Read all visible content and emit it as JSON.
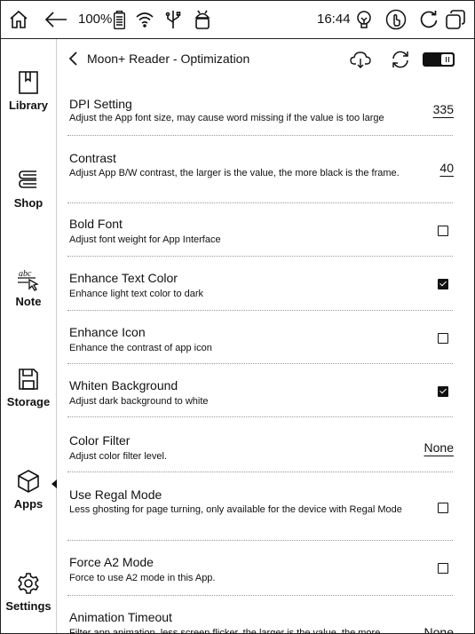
{
  "status_bar": {
    "battery_percent": "100%",
    "time": "16:44",
    "icons": [
      "home-icon",
      "back-arrow-icon",
      "battery-icon",
      "wifi-icon",
      "usb-icon",
      "android-icon",
      "bulb-icon",
      "touch-icon",
      "refresh-icon",
      "multitask-icon"
    ]
  },
  "sidebar": {
    "items": [
      {
        "label": "Library",
        "icon": "library-icon"
      },
      {
        "label": "Shop",
        "icon": "shop-icon"
      },
      {
        "label": "Note",
        "icon": "note-icon"
      },
      {
        "label": "Storage",
        "icon": "storage-icon"
      },
      {
        "label": "Apps",
        "icon": "apps-icon"
      },
      {
        "label": "Settings",
        "icon": "settings-icon"
      }
    ],
    "active": "Apps"
  },
  "header": {
    "title": "Moon+ Reader - Optimization",
    "icons": [
      "back-icon",
      "cloud-icon",
      "sync-icon"
    ],
    "toggle_on": true
  },
  "settings": [
    {
      "title": "DPI Setting",
      "desc": "Adjust the App font size, may cause word missing if the value is too large",
      "value": "335"
    },
    {
      "title": "Contrast",
      "desc": "Adjust App B/W contrast, the larger is the value, the more black is the frame.",
      "value": "40"
    },
    {
      "title": "Bold Font",
      "desc": "Adjust font weight for App Interface",
      "checked": false
    },
    {
      "title": "Enhance Text Color",
      "desc": "Enhance light text color to dark",
      "checked": true
    },
    {
      "title": "Enhance Icon",
      "desc": "Enhance the contrast of app icon",
      "checked": false
    },
    {
      "title": "Whiten Background",
      "desc": "Adjust dark background to white",
      "checked": true
    },
    {
      "title": "Color Filter",
      "desc": "Adjust color filter level.",
      "value": "None"
    },
    {
      "title": "Use Regal Mode",
      "desc": "Less ghosting for page turning, only available for the device with Regal Mode",
      "checked": false
    },
    {
      "title": "Force A2 Mode",
      "desc": "Force to use A2 mode in this App.",
      "checked": false
    },
    {
      "title": "Animation Timeout",
      "desc": "Filter app animation, less screen flicker, the larger is the value, the more",
      "value": "None"
    }
  ]
}
